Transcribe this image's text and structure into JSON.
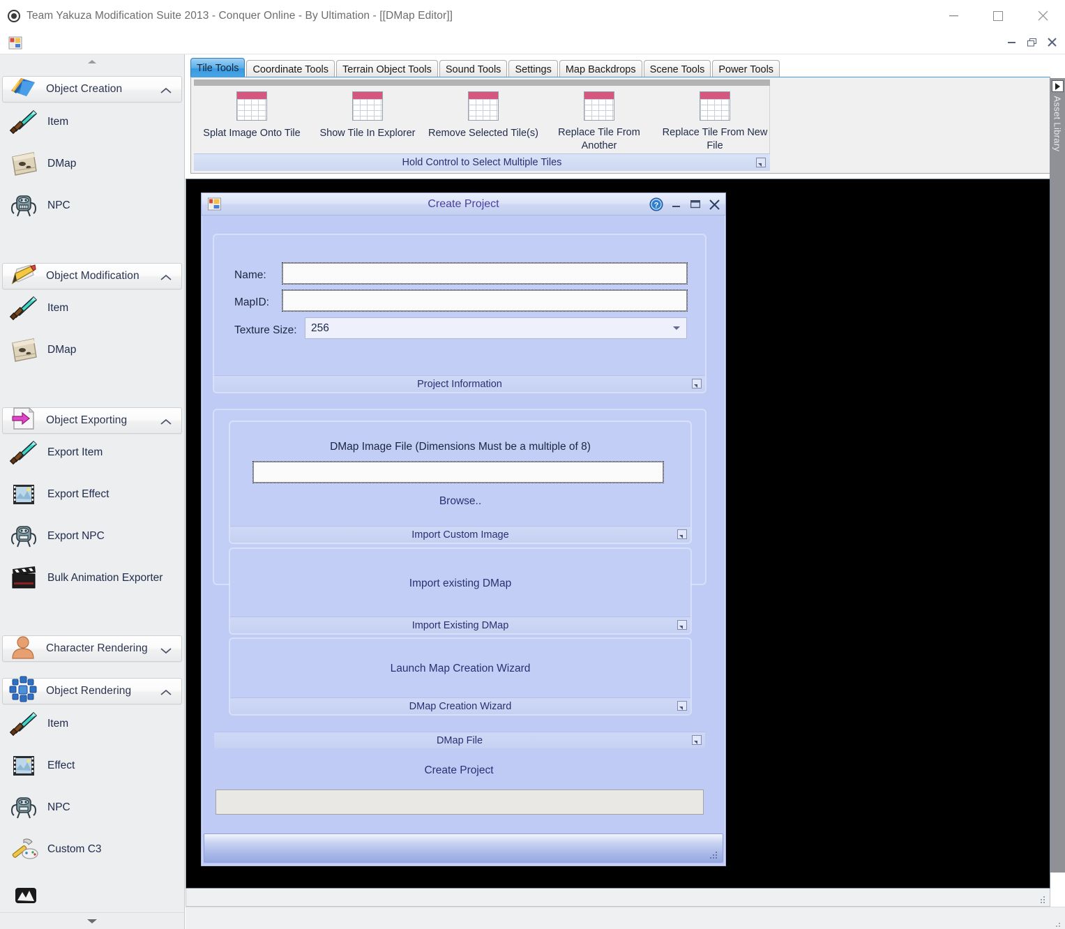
{
  "window": {
    "title": "Team Yakuza Modification Suite 2013 - Conquer Online - By Ultimation - [[DMap Editor]]",
    "icon": "app-logo-icon",
    "controls": {
      "minimize": "minimize-icon",
      "maximize": "maximize-icon",
      "close": "close-icon"
    }
  },
  "mdi": {
    "icon": "mdi-child-icon",
    "controls": {
      "minimize": "minimize-icon",
      "restore": "restore-icon",
      "close": "close-icon"
    }
  },
  "sidebar": {
    "scroll_up": "scroll-up-arrow",
    "scroll_down": "scroll-down-arrow",
    "groups": [
      {
        "label": "Object Creation",
        "icon": "map-layers-icon",
        "chevron": "chevron-up-icon",
        "items": [
          {
            "label": "Item",
            "icon": "sword-icon"
          },
          {
            "label": "DMap",
            "icon": "scroll-map-icon"
          },
          {
            "label": "NPC",
            "icon": "monster-icon"
          }
        ]
      },
      {
        "label": "Object Modification",
        "icon": "pencil-icon",
        "chevron": "chevron-up-icon",
        "items": [
          {
            "label": "Item",
            "icon": "sword-icon"
          },
          {
            "label": "DMap",
            "icon": "scroll-map-icon"
          }
        ]
      },
      {
        "label": "Object Exporting",
        "icon": "export-arrow-icon",
        "chevron": "chevron-up-icon",
        "items": [
          {
            "label": "Export Item",
            "icon": "sword-icon"
          },
          {
            "label": "Export Effect",
            "icon": "film-strip-icon"
          },
          {
            "label": "Export NPC",
            "icon": "monster-icon"
          },
          {
            "label": "Bulk Animation Exporter",
            "icon": "clapperboard-icon"
          }
        ]
      },
      {
        "label": "Character Rendering",
        "icon": "user-bust-icon",
        "chevron": "chevron-down-icon",
        "items": []
      },
      {
        "label": "Object Rendering",
        "icon": "snowflake-cubes-icon",
        "chevron": "chevron-up-icon",
        "items": [
          {
            "label": "Item",
            "icon": "sword-icon"
          },
          {
            "label": "Effect",
            "icon": "film-strip-icon"
          },
          {
            "label": "NPC",
            "icon": "monster-icon"
          },
          {
            "label": "Custom C3",
            "icon": "hammer-controller-icon"
          }
        ]
      }
    ]
  },
  "ribbon": {
    "tabs": [
      {
        "label": "Tile Tools",
        "active": true
      },
      {
        "label": "Coordinate Tools",
        "active": false
      },
      {
        "label": "Terrain Object Tools",
        "active": false
      },
      {
        "label": "Sound Tools",
        "active": false
      },
      {
        "label": "Settings",
        "active": false
      },
      {
        "label": "Map Backdrops",
        "active": false
      },
      {
        "label": "Scene Tools",
        "active": false
      },
      {
        "label": "Power Tools",
        "active": false
      }
    ],
    "group": {
      "footer_label": "Hold Control to Select Multiple Tiles",
      "launcher": "dialog-launcher-icon",
      "buttons": [
        {
          "label": "Splat Image Onto Tile",
          "icon": "tile-grid-icon"
        },
        {
          "label": "Show Tile In Explorer",
          "icon": "tile-grid-icon"
        },
        {
          "label": "Remove Selected Tile(s)",
          "icon": "tile-grid-icon"
        },
        {
          "label": "Replace Tile From Another",
          "icon": "tile-grid-icon"
        },
        {
          "label": "Replace Tile From New File",
          "icon": "tile-grid-icon"
        }
      ]
    }
  },
  "asset_dock": {
    "label": "Asset Library",
    "expander": "expand-right-icon"
  },
  "dialog": {
    "title": "Create Project",
    "icon": "create-project-icon",
    "controls": {
      "help": "help-icon",
      "minimize": "minimize-icon",
      "maximize": "maximize-icon",
      "close": "close-icon"
    },
    "project_information": {
      "footer_label": "Project Information",
      "launcher": "dialog-launcher-icon",
      "name_label": "Name:",
      "name_value": "",
      "mapid_label": "MapID:",
      "mapid_value": "",
      "texture_size_label": "Texture Size:",
      "texture_size_value": "256"
    },
    "dmap_file": {
      "footer_label": "DMap File",
      "launcher": "dialog-launcher-icon",
      "import_custom_image": {
        "heading": "DMap Image File (Dimensions Must be a multiple of 8)",
        "path_value": "",
        "browse_label": "Browse..",
        "footer_label": "Import Custom Image",
        "launcher": "dialog-launcher-icon"
      },
      "import_existing": {
        "button_label": "Import existing DMap",
        "footer_label": "Import Existing DMap",
        "launcher": "dialog-launcher-icon"
      },
      "creation_wizard": {
        "button_label": "Launch Map Creation Wizard",
        "footer_label": "DMap Creation Wizard",
        "launcher": "dialog-launcher-icon"
      }
    },
    "create_project_label": "Create Project",
    "progress_value": ""
  },
  "colors": {
    "accent_tab": "#3a9ae0",
    "dialog_bg": "#bfcbf5",
    "dialog_text": "#2b2f72",
    "title_text": "#4b3e9e",
    "canvas": "#000000",
    "tile_icon_header": "#d3577f"
  }
}
